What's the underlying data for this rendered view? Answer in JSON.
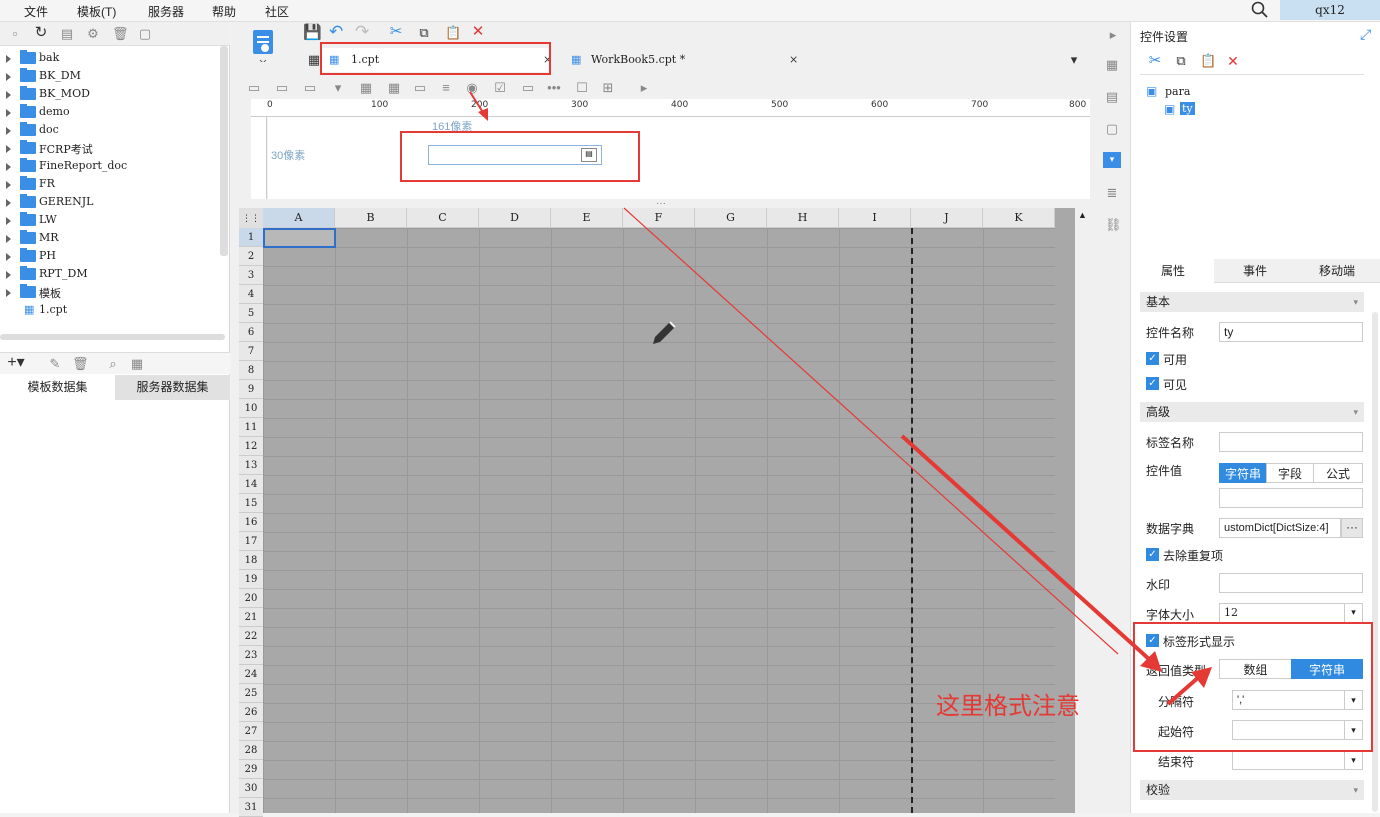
{
  "menu": [
    "文件",
    "模板(T)",
    "服务器",
    "帮助",
    "社区"
  ],
  "user": "qx12",
  "tree": [
    "bak",
    "BK_DM",
    "BK_MOD",
    "demo",
    "doc",
    "FCRP考试",
    "FineReport_doc",
    "FR",
    "GERENJL",
    "LW",
    "MR",
    "PH",
    "RPT_DM",
    "模板",
    "1.cpt"
  ],
  "dataset_tabs": [
    "模板数据集",
    "服务器数据集"
  ],
  "tabs": {
    "t1": "1.cpt",
    "t2": "WorkBook5.cpt *"
  },
  "ruler": [
    "0",
    "100",
    "200",
    "300",
    "400",
    "500",
    "600",
    "700",
    "800"
  ],
  "para": {
    "width_label": "161像素",
    "height_label": "30像素"
  },
  "columns": [
    "A",
    "B",
    "C",
    "D",
    "E",
    "F",
    "G",
    "H",
    "I",
    "J",
    "K"
  ],
  "rows": [
    "1",
    "2",
    "3",
    "4",
    "5",
    "6",
    "7",
    "8",
    "9",
    "10",
    "11",
    "12",
    "13",
    "14",
    "15",
    "16",
    "17",
    "18",
    "19",
    "20",
    "21",
    "22",
    "23",
    "24",
    "25",
    "26",
    "27",
    "28",
    "29",
    "30",
    "31"
  ],
  "panel": {
    "title": "控件设置",
    "tree": [
      "para",
      "ty"
    ],
    "tabs": [
      "属性",
      "事件",
      "移动端"
    ],
    "basic": "基本",
    "name_label": "控件名称",
    "name_value": "ty",
    "enabled": "可用",
    "visible": "可见",
    "advanced": "高级",
    "tag_name": "标签名称",
    "value_label": "控件值",
    "value_types": [
      "字符串",
      "字段",
      "公式"
    ],
    "dict_label": "数据字典",
    "dict_value": "ustomDict[DictSize:4]",
    "dedup": "去除重复项",
    "watermark": "水印",
    "font_size_label": "字体大小",
    "font_size": "12",
    "tag_display": "标签形式显示",
    "return_label": "返回值类型",
    "return_types": [
      "数组",
      "字符串"
    ],
    "sep_label": "分隔符",
    "sep_value": "','",
    "start_label": "起始符",
    "end_label": "结束符",
    "check": "校验"
  },
  "annotation": "这里格式注意"
}
